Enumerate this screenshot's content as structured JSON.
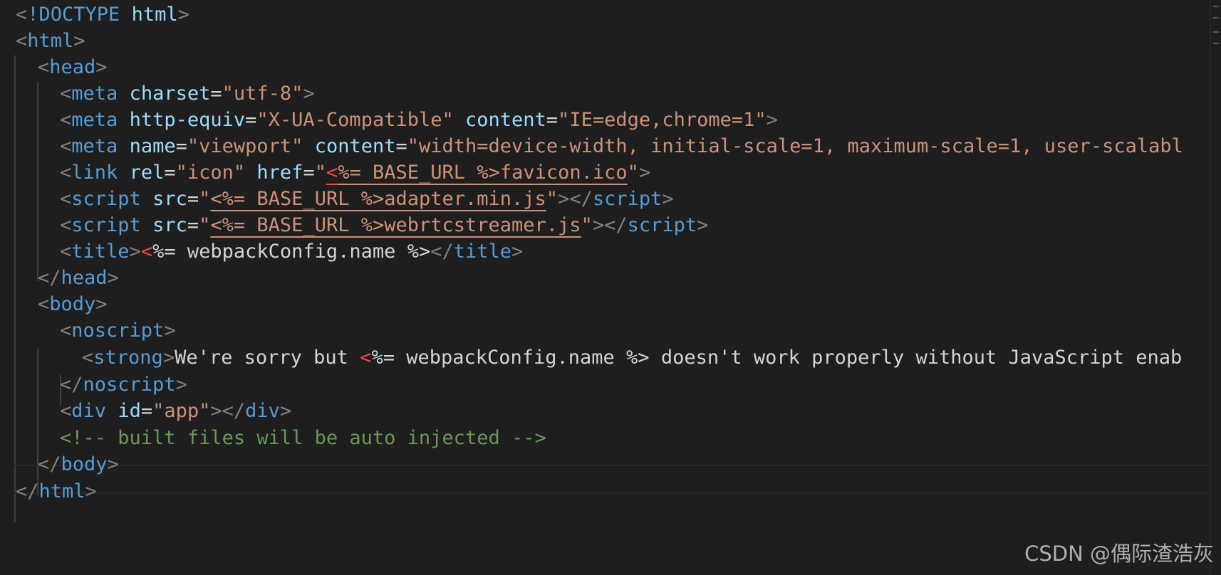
{
  "colors": {
    "background": "#1e1e1e",
    "punctuation": "#808080",
    "tag": "#569cd6",
    "attribute": "#9cdcfe",
    "string": "#ce9178",
    "text": "#d4d4d4",
    "error": "#f44747",
    "comment": "#6a9955"
  },
  "code": {
    "l1": {
      "doctype": "!DOCTYPE",
      "name": "html"
    },
    "l2": {
      "tag": "html"
    },
    "l3": {
      "tag": "head"
    },
    "l4": {
      "tag": "meta",
      "attr1": "charset",
      "val1": "\"utf-8\""
    },
    "l5": {
      "tag": "meta",
      "attr1": "http-equiv",
      "val1": "\"X-UA-Compatible\"",
      "attr2": "content",
      "val2": "\"IE=edge,chrome=1\""
    },
    "l6": {
      "tag": "meta",
      "attr1": "name",
      "val1": "\"viewport\"",
      "attr2": "content",
      "val2": "\"width=device-width, initial-scale=1, maximum-scale=1, user-scalabl"
    },
    "l7": {
      "tag": "link",
      "attr1": "rel",
      "val1": "\"icon\"",
      "attr2": "href",
      "quote_open": "\"",
      "err": "<",
      "val2": "%= BASE_URL %>favicon.ico",
      "quote_close": "\""
    },
    "l8": {
      "tag": "script",
      "attr1": "src",
      "quote_open": "\"",
      "val1": "<%= BASE_URL %>adapter.min.js",
      "quote_close": "\"",
      "close_tag": "script"
    },
    "l9": {
      "tag": "script",
      "attr1": "src",
      "quote_open": "\"",
      "val1": "<%= BASE_URL %>webrtcstreamer.js",
      "quote_close": "\"",
      "close_tag": "script"
    },
    "l10": {
      "tag": "title",
      "err": "<",
      "text": "%= webpackConfig.name %>",
      "close_tag": "title"
    },
    "l11": {
      "tag": "head"
    },
    "l12": {
      "tag": "body"
    },
    "l13": {
      "tag": "noscript"
    },
    "l14": {
      "tag": "strong",
      "text1": "We're sorry but ",
      "err": "<",
      "text2": "%= webpackConfig.name %> doesn't work properly without JavaScript enab"
    },
    "l15": {
      "tag": "noscript"
    },
    "l16": {
      "tag": "div",
      "attr1": "id",
      "val1": "\"app\"",
      "close_tag": "div"
    },
    "l17": {
      "comment": "<!-- built files will be auto injected -->"
    },
    "l18": {
      "tag": "body"
    },
    "l19": {
      "tag": "html"
    }
  },
  "watermark": "CSDN @偶际渣浩灰"
}
